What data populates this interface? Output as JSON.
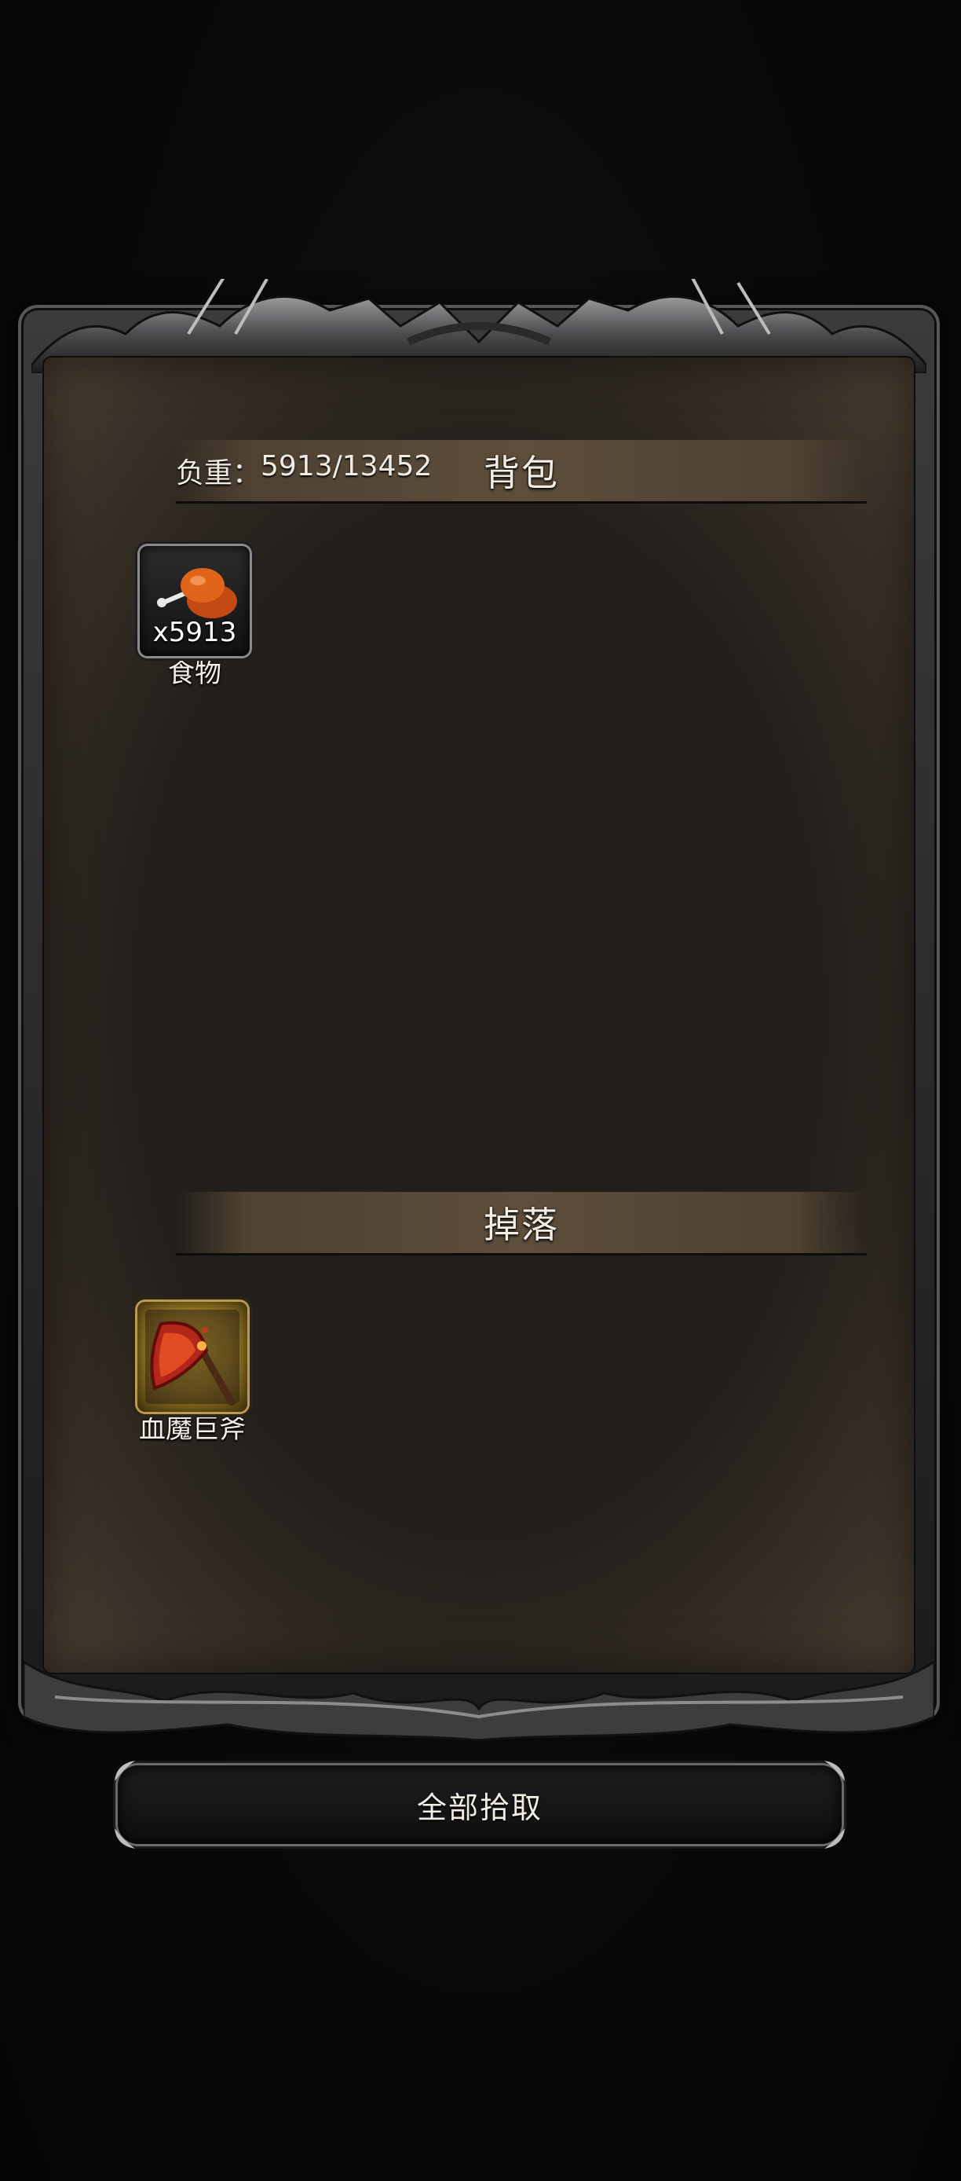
{
  "backpack": {
    "title": "背包",
    "weight_label": "负重：",
    "weight_value": "5913/13452",
    "items": [
      {
        "name": "食物",
        "quantity": "x5913",
        "icon": "drumstick-icon"
      }
    ]
  },
  "drops": {
    "title": "掉落",
    "items": [
      {
        "name": "血魔巨斧",
        "icon": "axe-icon"
      }
    ]
  },
  "actions": {
    "pickup_all_label": "全部拾取"
  },
  "colors": {
    "panel_bg": "#221e1a",
    "header_bar": "#5d4e3b",
    "axe_slot_gold": "#d7b63a"
  }
}
